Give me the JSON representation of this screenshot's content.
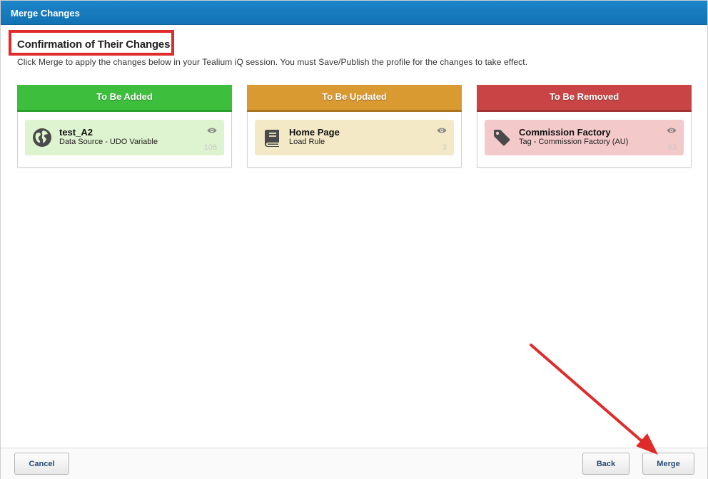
{
  "window": {
    "title": "Merge Changes"
  },
  "heading": "Confirmation of Their Changes",
  "description": "Click Merge to apply the changes below in your Tealium iQ session. You must Save/Publish the profile for the changes to take effect.",
  "colors": {
    "titlebar": "#1677bd",
    "added": "#3dbf3d",
    "updated": "#d99a32",
    "removed": "#c94545",
    "highlight": "#e02b2b"
  },
  "panels": [
    {
      "header": "To Be Added",
      "item": {
        "title": "test_A2",
        "subtitle": "Data Source - UDO Variable",
        "count": "106",
        "icon": "globe-icon"
      }
    },
    {
      "header": "To Be Updated",
      "item": {
        "title": "Home Page",
        "subtitle": "Load Rule",
        "count": "3",
        "icon": "book-icon"
      }
    },
    {
      "header": "To Be Removed",
      "item": {
        "title": "Commission Factory",
        "subtitle": "Tag - Commission Factory (AU)",
        "count": "63",
        "icon": "tag-icon"
      }
    }
  ],
  "footer": {
    "cancel_label": "Cancel",
    "back_label": "Back",
    "merge_label": "Merge"
  }
}
